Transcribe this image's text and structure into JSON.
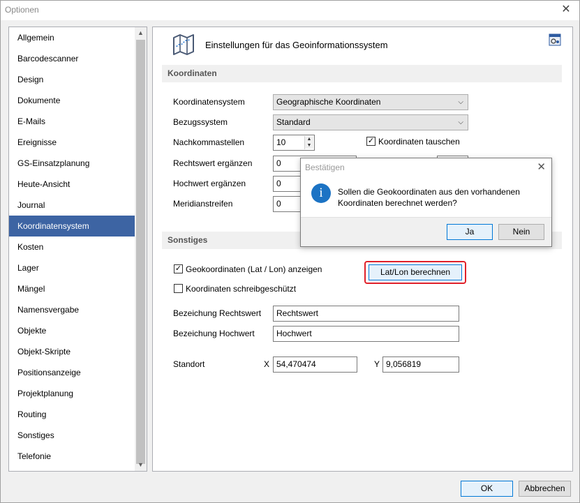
{
  "window": {
    "title": "Optionen",
    "close_glyph": "✕"
  },
  "nav": {
    "items": [
      "Allgemein",
      "Barcodescanner",
      "Design",
      "Dokumente",
      "E-Mails",
      "Ereignisse",
      "GS-Einsatzplanung",
      "Heute-Ansicht",
      "Journal",
      "Koordinatensystem",
      "Kosten",
      "Lager",
      "Mängel",
      "Namensvergabe",
      "Objekte",
      "Objekt-Skripte",
      "Positionsanzeige",
      "Projektplanung",
      "Routing",
      "Sonstiges",
      "Telefonie"
    ],
    "active_index": 9
  },
  "content": {
    "title": "Einstellungen für das Geoinformationssystem",
    "section_coordinates": "Koordinaten",
    "section_misc": "Sonstiges",
    "coordinate_system_label": "Koordinatensystem",
    "coordinate_system_value": "Geographische Koordinaten",
    "reference_system_label": "Bezugssystem",
    "reference_system_value": "Standard",
    "decimals_label": "Nachkommastellen",
    "decimals_value": "10",
    "swap_coords_label": "Koordinaten tauschen",
    "swap_coords_checked": true,
    "easting_add_label": "Rechtswert ergänzen",
    "easting_add_value": "0",
    "northing_add_label": "Hochwert ergänzen",
    "northing_add_value": "0",
    "meridian_label": "Meridianstreifen",
    "meridian_value": "0",
    "show_geo_label": "Geokoordinaten (Lat / Lon) anzeigen",
    "show_geo_checked": true,
    "calc_button": "Lat/Lon berechnen",
    "readonly_label": "Koordinaten schreibgeschützt",
    "readonly_checked": false,
    "easting_name_label": "Bezeichung Rechtswert",
    "easting_name_value": "Rechtswert",
    "northing_name_label": "Bezeichung Hochwert",
    "northing_name_value": "Hochwert",
    "location_label": "Standort",
    "x_label": "X",
    "x_value": "54,470474",
    "y_label": "Y",
    "y_value": "9,056819"
  },
  "footer": {
    "ok": "OK",
    "cancel": "Abbrechen"
  },
  "modal": {
    "title": "Bestätigen",
    "message": "Sollen die Geokoordinaten aus den vorhandenen Koordinaten berechnet werden?",
    "yes": "Ja",
    "no": "Nein",
    "close_glyph": "✕",
    "info_glyph": "i"
  },
  "colors": {
    "accent": "#3d64a3",
    "highlight": "#e0202a",
    "info": "#1c73c4"
  },
  "icons": {
    "header": "map-icon",
    "corner": "settings-user-icon"
  }
}
